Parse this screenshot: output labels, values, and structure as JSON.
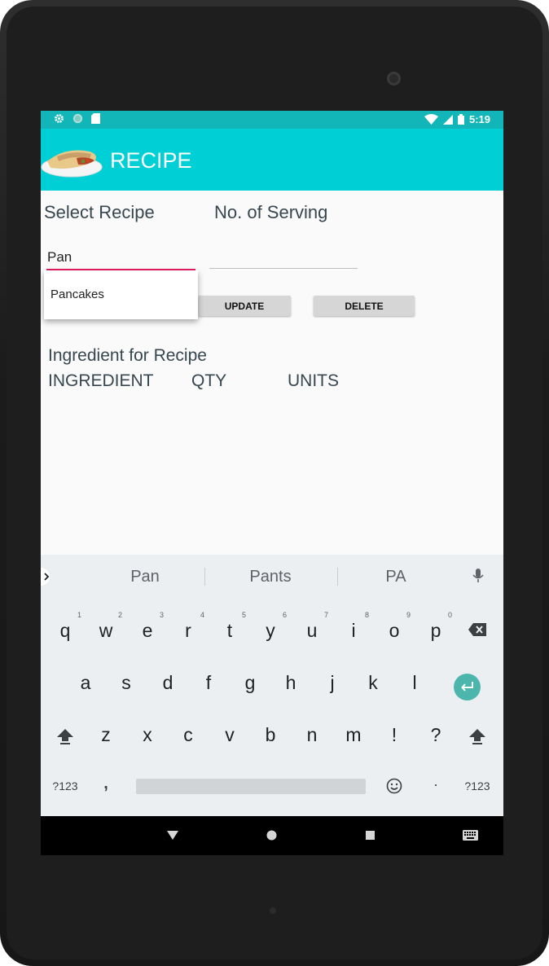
{
  "status_bar": {
    "time": "5:19"
  },
  "app_bar": {
    "title": "RECIPE"
  },
  "form": {
    "select_recipe_label": "Select Recipe",
    "servings_label": "No. of Serving",
    "recipe_input_value": "Pan",
    "autocomplete": [
      "Pancakes"
    ],
    "update_button": "UPDATE",
    "delete_button": "DELETE"
  },
  "ingredients": {
    "heading": "Ingredient for Recipe",
    "columns": [
      "INGREDIENT",
      "QTY",
      "UNITS"
    ]
  },
  "keyboard": {
    "suggestions": [
      "Pan",
      "Pants",
      "PA"
    ],
    "row1": [
      "q",
      "w",
      "e",
      "r",
      "t",
      "y",
      "u",
      "i",
      "o",
      "p"
    ],
    "row1_hints": [
      "1",
      "2",
      "3",
      "4",
      "5",
      "6",
      "7",
      "8",
      "9",
      "0"
    ],
    "row2": [
      "a",
      "s",
      "d",
      "f",
      "g",
      "h",
      "j",
      "k",
      "l"
    ],
    "row3": [
      "z",
      "x",
      "c",
      "v",
      "b",
      "n",
      "m",
      "!",
      "?"
    ],
    "symbols_label": "?123",
    "comma": ",",
    "period": "·",
    "symbols_label_right": "?123"
  },
  "colors": {
    "status_bar": "#13b6b8",
    "app_bar": "#00cfd6",
    "accent": "#e91e63",
    "enter_key": "#4db6ac"
  }
}
